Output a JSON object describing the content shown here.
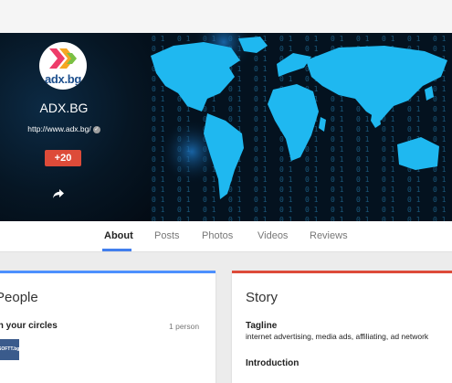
{
  "profile": {
    "logo_text": "adx.bg",
    "name": "ADX.BG",
    "url": "http://www.adx.bg/",
    "plus_button": "+20"
  },
  "tabs": [
    {
      "label": "About",
      "active": true
    },
    {
      "label": "Posts",
      "active": false
    },
    {
      "label": "Photos",
      "active": false
    },
    {
      "label": "Videos",
      "active": false
    },
    {
      "label": "Reviews",
      "active": false
    }
  ],
  "people_card": {
    "title": "People",
    "circles_label": "In your circles",
    "count": "1 person",
    "thumb_text": "SOFTT.bg"
  },
  "story_card": {
    "title": "Story",
    "tagline_label": "Tagline",
    "tagline": "internet advertising, media ads, affiliating, ad network",
    "intro_label": "Introduction"
  },
  "colors": {
    "accent_blue": "#4d90fe",
    "accent_red": "#dd4b39",
    "map_cyan": "#1fb8f0"
  },
  "icons": [
    "verified-icon",
    "share-icon"
  ]
}
